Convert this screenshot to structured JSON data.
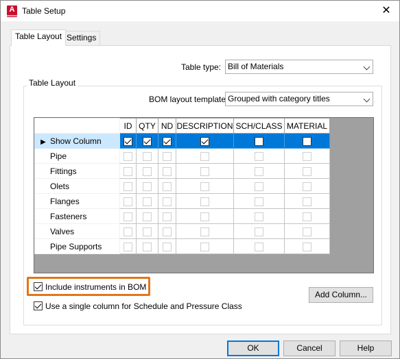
{
  "window": {
    "title": "Table Setup",
    "app_icon_letter": "A",
    "close_glyph": "✕"
  },
  "tabs": [
    {
      "label": "Table Layout",
      "active": true
    },
    {
      "label": "Settings",
      "active": false
    }
  ],
  "table_type": {
    "label": "Table type:",
    "value": "Bill of Materials"
  },
  "group": {
    "title": "Table Layout"
  },
  "bom_template": {
    "label": "BOM layout template:",
    "value": "Grouped with category titles"
  },
  "grid": {
    "columns": [
      "ID",
      "QTY",
      "ND",
      "DESCRIPTION",
      "SCH/CLASS",
      "MATERIAL"
    ],
    "row_pointer": "▶",
    "rows": [
      {
        "label": "Show Column",
        "selected": true,
        "checked": [
          true,
          true,
          true,
          true,
          false,
          false
        ],
        "enabled": true
      },
      {
        "label": "Pipe",
        "selected": false,
        "checked": [
          false,
          false,
          false,
          false,
          false,
          false
        ],
        "enabled": false
      },
      {
        "label": "Fittings",
        "selected": false,
        "checked": [
          false,
          false,
          false,
          false,
          false,
          false
        ],
        "enabled": false
      },
      {
        "label": "Olets",
        "selected": false,
        "checked": [
          false,
          false,
          false,
          false,
          false,
          false
        ],
        "enabled": false
      },
      {
        "label": "Flanges",
        "selected": false,
        "checked": [
          false,
          false,
          false,
          false,
          false,
          false
        ],
        "enabled": false
      },
      {
        "label": "Fasteners",
        "selected": false,
        "checked": [
          false,
          false,
          false,
          false,
          false,
          false
        ],
        "enabled": false
      },
      {
        "label": "Valves",
        "selected": false,
        "checked": [
          false,
          false,
          false,
          false,
          false,
          false
        ],
        "enabled": false
      },
      {
        "label": "Pipe Supports",
        "selected": false,
        "checked": [
          false,
          false,
          false,
          false,
          false,
          false
        ],
        "enabled": false
      }
    ]
  },
  "options": {
    "include_instruments": {
      "label": "Include instruments in BOM",
      "checked": true
    },
    "single_column": {
      "label": "Use a single column for Schedule and Pressure Class",
      "checked": true
    }
  },
  "buttons": {
    "add_column": "Add Column...",
    "ok": "OK",
    "cancel": "Cancel",
    "help": "Help"
  },
  "colors": {
    "highlight": "#e0761a",
    "selection": "#0078d7",
    "row_selection": "#cce8ff",
    "app_icon": "#c8102e"
  }
}
